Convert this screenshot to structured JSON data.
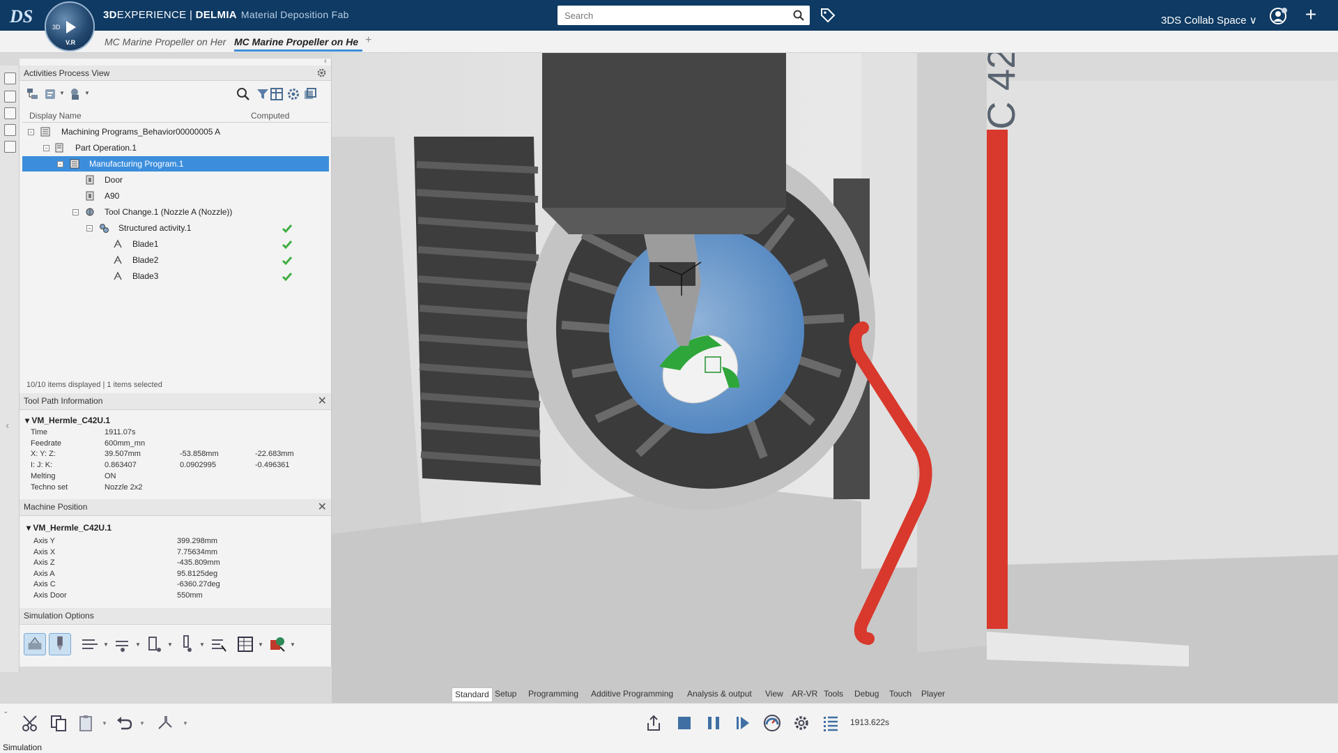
{
  "header": {
    "brand_bold": "3D",
    "brand_light": "EXPERIENCE",
    "brand_sep": " | ",
    "app_name": "DELMIA",
    "app_sub": "Material Deposition Fab",
    "compass_3d": "3D",
    "compass_version": "V.R",
    "search_placeholder": "Search",
    "collab_space": "3DS Collab Space ∨"
  },
  "tabs": [
    {
      "label": "MC Marine Propeller on Her"
    },
    {
      "label": "MC Marine Propeller on He"
    }
  ],
  "tab_add": "+",
  "activities": {
    "title": "Activities Process View",
    "col_display": "Display Name",
    "col_computed": "Computed",
    "tree": [
      {
        "label": "Machining Programs_Behavior00000005 A"
      },
      {
        "label": "Part Operation.1"
      },
      {
        "label": "Manufacturing Program.1"
      },
      {
        "label": "Door"
      },
      {
        "label": "A90"
      },
      {
        "label": "Tool Change.1 (Nozzle A (Nozzle))"
      },
      {
        "label": "Structured activity.1"
      },
      {
        "label": "Blade1"
      },
      {
        "label": "Blade2"
      },
      {
        "label": "Blade3"
      }
    ],
    "status": "10/10 items displayed | 1 items selected"
  },
  "toolpath": {
    "title": "Tool Path Information",
    "machine": "VM_Hermle_C42U.1",
    "rows": [
      {
        "label": "Time",
        "v1": "1911.07s",
        "v2": "",
        "v3": ""
      },
      {
        "label": "Feedrate",
        "v1": "600mm_mn",
        "v2": "",
        "v3": ""
      },
      {
        "label": "X: Y: Z:",
        "v1": "39.507mm",
        "v2": "-53.858mm",
        "v3": "-22.683mm"
      },
      {
        "label": "I: J: K:",
        "v1": "0.863407",
        "v2": "0.0902995",
        "v3": "-0.496361"
      },
      {
        "label": "Melting",
        "v1": "ON",
        "v2": "",
        "v3": ""
      },
      {
        "label": "Techno set",
        "v1": "Nozzle 2x2",
        "v2": "",
        "v3": ""
      }
    ]
  },
  "machine_position": {
    "title": "Machine Position",
    "machine": "VM_Hermle_C42U.1",
    "rows": [
      {
        "label": "Axis Y",
        "value": "399.298mm"
      },
      {
        "label": "Axis X",
        "value": "7.75634mm"
      },
      {
        "label": "Axis Z",
        "value": "-435.809mm"
      },
      {
        "label": "Axis A",
        "value": "95.8125deg"
      },
      {
        "label": "Axis C",
        "value": "-6360.27deg"
      },
      {
        "label": "Axis Door",
        "value": "550mm"
      }
    ]
  },
  "simulation_options": {
    "title": "Simulation Options"
  },
  "viewport": {
    "machine_text": "C 42"
  },
  "action_tabs": [
    {
      "label": "Standard"
    },
    {
      "label": "Setup"
    },
    {
      "label": "Programming"
    },
    {
      "label": "Additive Programming"
    },
    {
      "label": "Analysis & output"
    },
    {
      "label": "View"
    },
    {
      "label": "AR-VR"
    },
    {
      "label": "Tools"
    },
    {
      "label": "Debug"
    },
    {
      "label": "Touch"
    },
    {
      "label": "Player"
    }
  ],
  "player": {
    "time": "1913.622s"
  },
  "statusbar": {
    "text": "Simulation"
  },
  "colors": {
    "topbar": "#0e3a63",
    "selection": "#3c8edc",
    "check": "#3fae3f",
    "nozzle_red": "#d9382c"
  }
}
